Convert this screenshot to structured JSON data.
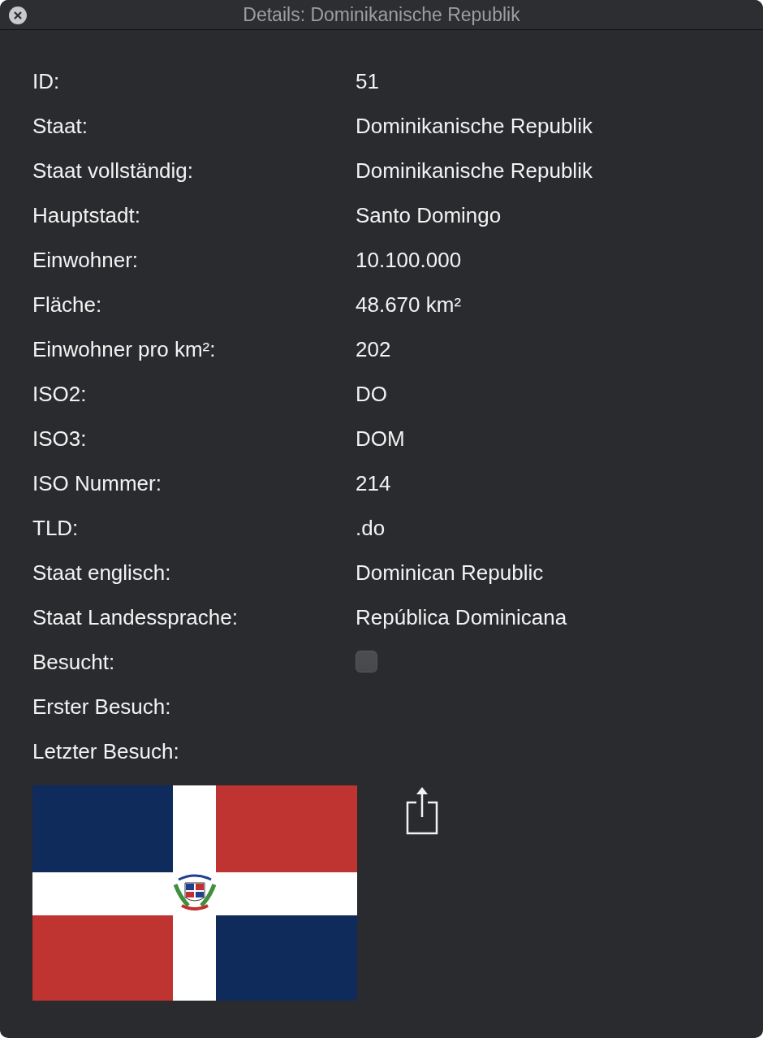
{
  "window": {
    "title": "Details: Dominikanische Republik"
  },
  "fields": [
    {
      "kind": "text",
      "label": "ID:",
      "value": "51"
    },
    {
      "kind": "text",
      "label": "Staat:",
      "value": "Dominikanische Republik"
    },
    {
      "kind": "text",
      "label": "Staat vollständig:",
      "value": "Dominikanische Republik"
    },
    {
      "kind": "text",
      "label": "Hauptstadt:",
      "value": "Santo Domingo"
    },
    {
      "kind": "text",
      "label": "Einwohner:",
      "value": "10.100.000"
    },
    {
      "kind": "text",
      "label": "Fläche:",
      "value": "48.670 km²"
    },
    {
      "kind": "text",
      "label": "Einwohner pro km²:",
      "value": "202"
    },
    {
      "kind": "text",
      "label": "ISO2:",
      "value": "DO"
    },
    {
      "kind": "text",
      "label": "ISO3:",
      "value": "DOM"
    },
    {
      "kind": "text",
      "label": "ISO Nummer:",
      "value": "214"
    },
    {
      "kind": "text",
      "label": "TLD:",
      "value": ".do"
    },
    {
      "kind": "text",
      "label": "Staat englisch:",
      "value": "Dominican Republic"
    },
    {
      "kind": "text",
      "label": "Staat Landessprache:",
      "value": "República Dominicana"
    },
    {
      "kind": "checkbox",
      "label": "Besucht:",
      "checked": false
    },
    {
      "kind": "text",
      "label": "Erster Besuch:"
    },
    {
      "kind": "text",
      "label": "Letzter Besuch:"
    }
  ]
}
